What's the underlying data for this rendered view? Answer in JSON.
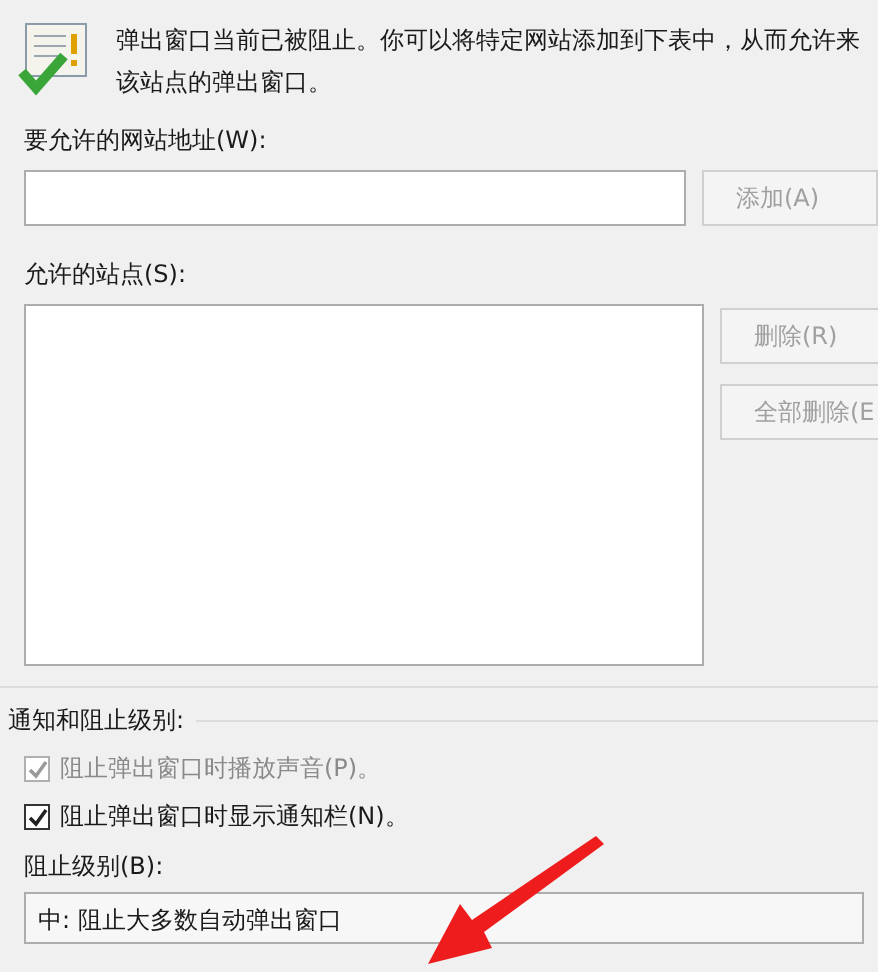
{
  "header": {
    "lines": [
      "弹出窗口当前已被阻止。你可以将特定网站添加到下表中，从而允许来",
      "该站点的弹出窗口。"
    ]
  },
  "address": {
    "label": "要允许的网站地址(W):",
    "add_button": {
      "label": "添加(A)",
      "disabled": true
    }
  },
  "allowed_sites": {
    "label": "允许的站点(S):",
    "buttons": [
      {
        "label": "删除(R)",
        "disabled": true
      },
      {
        "label": "全部删除(E",
        "disabled": true
      }
    ]
  },
  "notification": {
    "title": "通知和阻止级别:",
    "options": [
      {
        "label": "阻止弹出窗口时播放声音(P)。",
        "checked": true,
        "disabled": true
      },
      {
        "label": "阻止弹出窗口时显示通知栏(N)。",
        "checked": true,
        "disabled": false
      }
    ],
    "level_label": "阻止级别(B):",
    "level_value": "中: 阻止大多数自动弹出窗口"
  }
}
